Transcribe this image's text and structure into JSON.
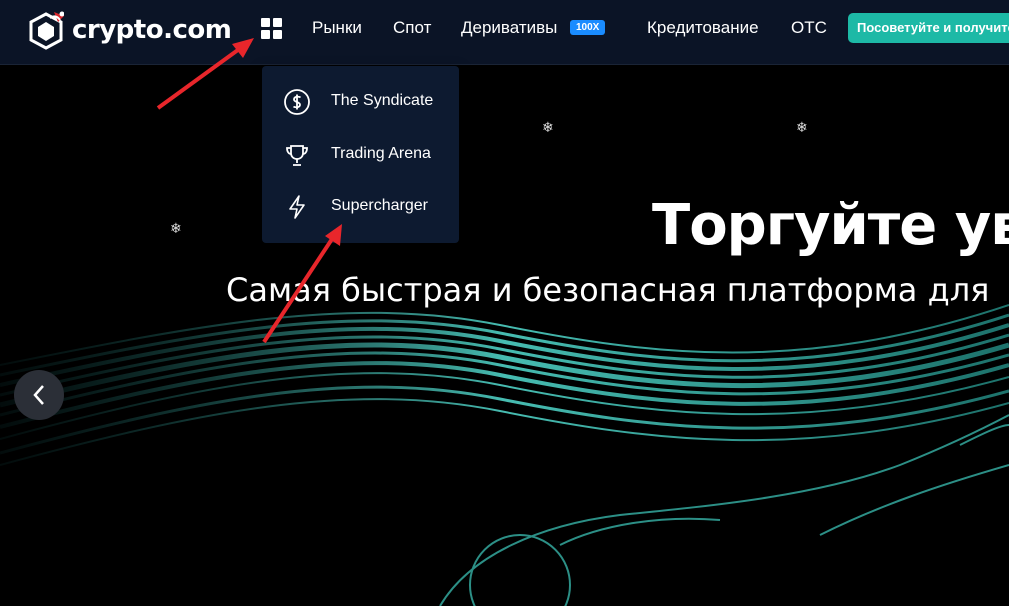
{
  "header": {
    "logo_text": "crypto.com",
    "nav": [
      {
        "label": "Рынки"
      },
      {
        "label": "Спот"
      },
      {
        "label": "Деривативы",
        "badge": "100X"
      },
      {
        "label": "Кредитование"
      },
      {
        "label": "OTC"
      }
    ],
    "cta_label": "Посоветуйте и получите",
    "cta_color": "#1db9a6",
    "badge_color": "#1a8cff"
  },
  "dropdown": {
    "items": [
      {
        "label": "The Syndicate",
        "icon": "dollar-coin-icon"
      },
      {
        "label": "Trading Arena",
        "icon": "trophy-icon"
      },
      {
        "label": "Supercharger",
        "icon": "lightning-icon"
      }
    ]
  },
  "hero": {
    "title": "Торгуйте уверенно",
    "subtitle": "Самая быстрая и безопасная платформа для"
  },
  "annotation_color": "#e8262b"
}
